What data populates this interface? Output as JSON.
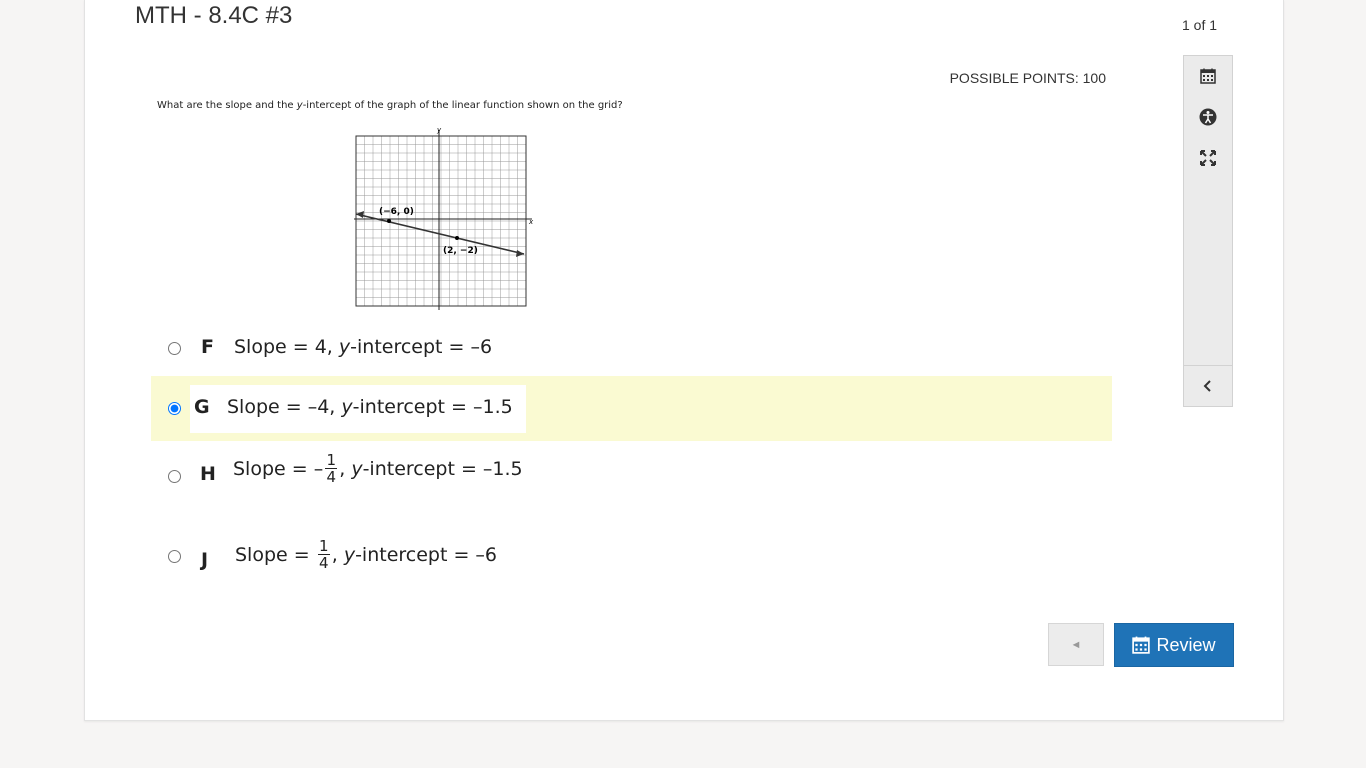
{
  "header": {
    "title": "MTH - 8.4C #3",
    "pager": "1 of 1"
  },
  "question": {
    "points_label": "POSSIBLE POINTS: 100",
    "stem_before": "What are the slope and the ",
    "stem_var": "y",
    "stem_after": "-intercept of the graph of the linear function shown on the grid?",
    "graph": {
      "x_label": "x",
      "y_label": "y",
      "point1_label": "(−6, 0)",
      "point2_label": "(2, −2)",
      "x_range": [
        -9,
        9
      ],
      "y_range": [
        -9,
        9
      ]
    }
  },
  "options": [
    {
      "letter": "F",
      "slope_label": "Slope = 4,",
      "var": "y",
      "intercept_label": "-intercept = –6",
      "selected": false
    },
    {
      "letter": "G",
      "slope_label": "Slope = –4,",
      "var": "y",
      "intercept_label": "-intercept = –1.5",
      "selected": true
    },
    {
      "letter": "H",
      "slope_prefix": "Slope = –",
      "num": "1",
      "den": "4",
      "var": "y",
      "intercept_label": "-intercept = –1.5",
      "selected": false
    },
    {
      "letter": "J",
      "slope_prefix": "Slope =",
      "num": "1",
      "den": "4",
      "var": "y",
      "intercept_label": "-intercept = –6",
      "selected": false
    }
  ],
  "toolbar": {
    "icons": [
      "calendar-icon",
      "accessibility-icon",
      "fullscreen-icon",
      "chevron-left-icon"
    ]
  },
  "nav": {
    "prev_symbol": "◄",
    "review_label": "Review"
  },
  "colors": {
    "selected_bg": "#fafad2",
    "primary": "#1f73b7"
  }
}
